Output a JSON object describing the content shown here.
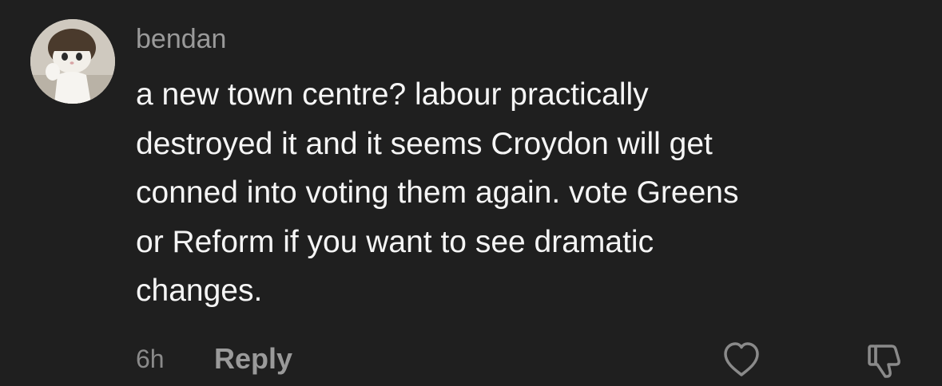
{
  "comment": {
    "username": "bendan",
    "text_lines": [
      "a new town centre? labour practically",
      "destroyed it and it seems Croydon will get",
      "conned into voting them again. vote Greens",
      "or Reform if you want to see dramatic",
      "changes."
    ],
    "timestamp": "6h",
    "reply_label": "Reply",
    "icons": {
      "avatar": "cat-avatar",
      "like": "heart-icon",
      "dislike": "thumbs-down-icon"
    }
  },
  "colors": {
    "background": "#1f1f1f",
    "text_primary": "#f5f5f5",
    "text_secondary": "#9a9a9a"
  }
}
